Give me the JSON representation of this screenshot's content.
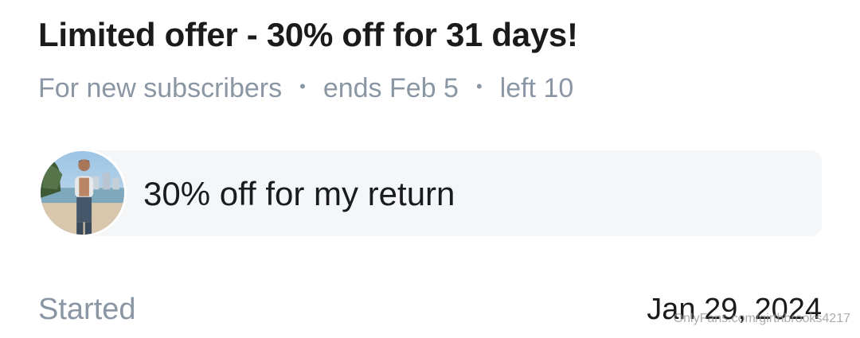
{
  "offer": {
    "title": "Limited offer - 30% off for 31 days!",
    "audience": "For new subscribers",
    "ends": "ends Feb 5",
    "remaining": "left 10",
    "separator": "•"
  },
  "message": {
    "text": "30% off for my return",
    "avatar_icon": "creator-avatar",
    "bubble_color": "#f4f6f8"
  },
  "footer": {
    "label": "Started",
    "date": "Jan 29, 2024"
  },
  "watermark": {
    "text": "OnlyFans.com/girthbrooks4217"
  },
  "colors": {
    "primary_text": "#1a1b1d",
    "secondary_text": "#8a96a3"
  }
}
